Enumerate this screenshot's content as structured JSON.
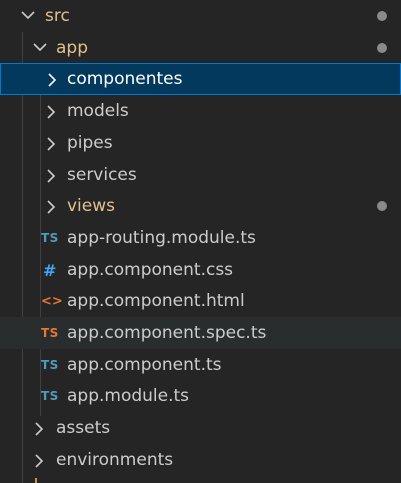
{
  "explorer": {
    "colors": {
      "background": "#252526",
      "selection_bg": "#04395e",
      "selection_border": "#0078d4",
      "modified_folder_text": "#e2c08d",
      "default_text": "#cccccc",
      "modified_dot": "#8a8a8a",
      "ts_icon": "#519aba",
      "spec_icon": "#e37933"
    },
    "items": [
      {
        "label": "src",
        "kind": "folder",
        "expanded": true,
        "modified": true,
        "icon": "chevron-down-icon"
      },
      {
        "label": "app",
        "kind": "folder",
        "expanded": true,
        "modified": true,
        "icon": "chevron-down-icon"
      },
      {
        "label": "componentes",
        "kind": "folder",
        "expanded": false,
        "selected": true,
        "icon": "chevron-right-icon"
      },
      {
        "label": "models",
        "kind": "folder",
        "expanded": false,
        "icon": "chevron-right-icon"
      },
      {
        "label": "pipes",
        "kind": "folder",
        "expanded": false,
        "icon": "chevron-right-icon"
      },
      {
        "label": "services",
        "kind": "folder",
        "expanded": false,
        "icon": "chevron-right-icon"
      },
      {
        "label": "views",
        "kind": "folder",
        "expanded": false,
        "modified": true,
        "icon": "chevron-right-icon"
      },
      {
        "label": "app-routing.module.ts",
        "kind": "file",
        "icon": "typescript-icon",
        "badge": "TS"
      },
      {
        "label": "app.component.css",
        "kind": "file",
        "icon": "css-icon",
        "badge": "#"
      },
      {
        "label": "app.component.html",
        "kind": "file",
        "icon": "html-icon",
        "badge": "<>"
      },
      {
        "label": "app.component.spec.ts",
        "kind": "file",
        "icon": "typescript-spec-icon",
        "badge": "TS",
        "hovered": true
      },
      {
        "label": "app.component.ts",
        "kind": "file",
        "icon": "typescript-icon",
        "badge": "TS"
      },
      {
        "label": "app.module.ts",
        "kind": "file",
        "icon": "typescript-icon",
        "badge": "TS"
      },
      {
        "label": "assets",
        "kind": "folder",
        "expanded": false,
        "icon": "chevron-right-icon"
      },
      {
        "label": "environments",
        "kind": "folder",
        "expanded": false,
        "icon": "chevron-right-icon"
      }
    ]
  }
}
